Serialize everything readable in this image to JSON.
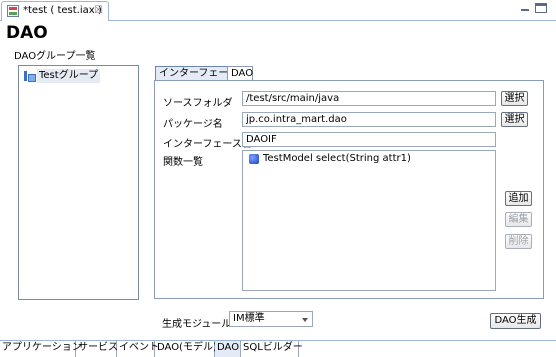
{
  "editor": {
    "tab_title": "*test ( test.iax )",
    "close_glyph": "☒",
    "file_icon": "app-file-icon"
  },
  "page": {
    "title": "DAO",
    "group_list_label": "DAOグループ一覧"
  },
  "tree": {
    "items": [
      {
        "label": "Testグループ",
        "icon": "group-icon"
      }
    ]
  },
  "right_panel": {
    "tabs": [
      {
        "label": "インターフェース",
        "active": true
      },
      {
        "label": "DAO",
        "active": false
      }
    ],
    "source_folder": {
      "label": "ソースフォルダ",
      "value": "/test/src/main/java",
      "button": "選択"
    },
    "package": {
      "label": "パッケージ名",
      "value": "jp.co.intra_mart.dao",
      "button": "選択"
    },
    "interface_name": {
      "label": "インターフェース名",
      "value": "DAOIF"
    },
    "functions": {
      "label": "関数一覧",
      "items": [
        {
          "label": "TestModel select(String attr1)",
          "icon": "method-cube-icon"
        }
      ],
      "add_button": "追加",
      "edit_button": "編集",
      "delete_button": "削除"
    }
  },
  "bottom": {
    "module_label": "生成モジュール",
    "module_value": "IM標準",
    "generate_button": "DAO生成"
  },
  "page_tabs": [
    {
      "label": "アプリケーション",
      "active": false
    },
    {
      "label": "サービス",
      "active": false
    },
    {
      "label": "イベント",
      "active": false
    },
    {
      "label": "DAO(モデル)",
      "active": false
    },
    {
      "label": "DAO",
      "active": true
    },
    {
      "label": "SQLビルダー",
      "active": false
    }
  ]
}
